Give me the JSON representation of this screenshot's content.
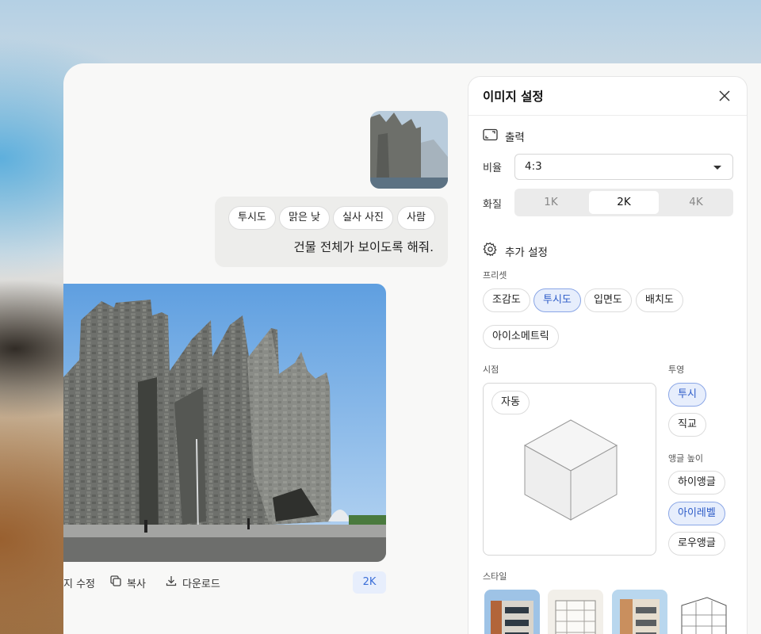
{
  "chat": {
    "request_chips": [
      "투시도",
      "맑은 낮",
      "실사 사진",
      "사람"
    ],
    "request_text": "건물 전체가 보이도록 해줘.",
    "actions": {
      "edit_label": "지 수정",
      "copy_label": "복사",
      "download_label": "다운로드"
    },
    "resolution_badge": "2K"
  },
  "panel": {
    "title": "이미지 설정",
    "output": {
      "heading": "출력",
      "ratio_label": "비율",
      "ratio_value": "4:3",
      "quality_label": "화질",
      "quality_options": [
        "1K",
        "2K",
        "4K"
      ],
      "quality_selected": "2K"
    },
    "extra": {
      "heading": "추가 설정",
      "preset_label": "프리셋",
      "presets": [
        "조감도",
        "투시도",
        "입면도",
        "배치도",
        "아이소메트릭"
      ],
      "preset_selected": "투시도",
      "viewpoint_label": "시점",
      "viewpoint_value": "자동",
      "projection_label": "투영",
      "projections": [
        "투시",
        "직교"
      ],
      "projection_selected": "투시",
      "angle_label": "앵글 높이",
      "angles": [
        "하이앵글",
        "아이레벨",
        "로우앵글"
      ],
      "angle_selected": "아이레벨",
      "style_label": "스타일"
    }
  },
  "colors": {
    "accent": "#2c5bc8",
    "accent_bg": "#e7eefc",
    "panel_bg": "#ffffff",
    "app_bg": "#f8f8f7"
  }
}
